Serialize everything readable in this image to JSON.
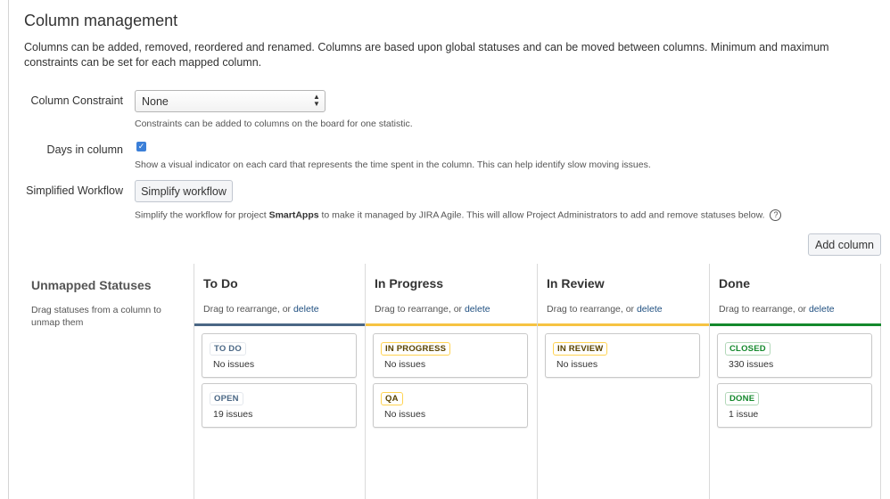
{
  "page": {
    "title": "Column management",
    "description": "Columns can be added, removed, reordered and renamed. Columns are based upon global statuses and can be moved between columns. Minimum and maximum constraints can be set for each mapped column."
  },
  "constraint": {
    "label": "Column Constraint",
    "value": "None",
    "help": "Constraints can be added to columns on the board for one statistic."
  },
  "days": {
    "label": "Days in column",
    "checked": true,
    "help": "Show a visual indicator on each card that represents the time spent in the column. This can help identify slow moving issues."
  },
  "workflow": {
    "label": "Simplified Workflow",
    "button": "Simplify workflow",
    "help_prefix": "Simplify the workflow for project ",
    "help_project": "SmartApps",
    "help_suffix": " to make it managed by JIRA Agile. This will allow Project Administrators to add and remove statuses below.",
    "help_icon": "?"
  },
  "add_column": "Add column",
  "unmapped": {
    "title": "Unmapped Statuses",
    "description": "Drag statuses from a column to unmap them"
  },
  "columns": [
    {
      "title": "To Do",
      "sub_prefix": "Drag to rearrange, or ",
      "delete_label": "delete",
      "bar_color": "#4a6785",
      "statuses": [
        {
          "name": "TO DO",
          "count": "No issues",
          "color": "blue"
        },
        {
          "name": "OPEN",
          "count": "19 issues",
          "color": "blue"
        }
      ]
    },
    {
      "title": "In Progress",
      "sub_prefix": "Drag to rearrange, or ",
      "delete_label": "delete",
      "bar_color": "#f6c342",
      "statuses": [
        {
          "name": "IN PROGRESS",
          "count": "No issues",
          "color": "yellow"
        },
        {
          "name": "QA",
          "count": "No issues",
          "color": "yellow"
        }
      ]
    },
    {
      "title": "In Review",
      "sub_prefix": "Drag to rearrange, or ",
      "delete_label": "delete",
      "bar_color": "#f6c342",
      "statuses": [
        {
          "name": "IN REVIEW",
          "count": "No issues",
          "color": "yellow"
        }
      ]
    },
    {
      "title": "Done",
      "sub_prefix": "Drag to rearrange, or ",
      "delete_label": "delete",
      "bar_color": "#14892c",
      "statuses": [
        {
          "name": "CLOSED",
          "count": "330 issues",
          "color": "green"
        },
        {
          "name": "DONE",
          "count": "1 issue",
          "color": "green"
        }
      ]
    }
  ]
}
